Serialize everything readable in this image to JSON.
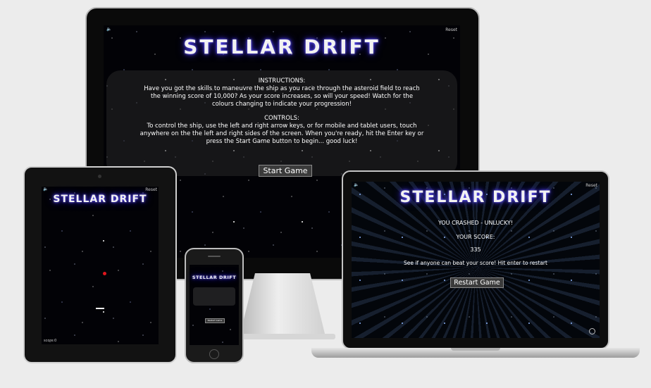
{
  "game": {
    "title": "STELLAR DRIFT",
    "reset_label": "Reset",
    "sound_icon": "speaker-icon",
    "instructions_heading": "INSTRUCTIONS:",
    "instructions_line1": "Have you got the skills to maneuvre the ship as you race through the asteroid field to reach",
    "instructions_line2": "the winning score of 10,000? As your score increases, so will your speed! Watch for the",
    "instructions_line3": "colours changing to indicate your progression!",
    "controls_heading": "CONTROLS:",
    "controls_line1": "To control the ship, use the left and right arrow keys, or for mobile and tablet users, touch",
    "controls_line2": "anywhere on the the left and right sides of the screen. When you're ready, hit the Enter key or",
    "controls_line3": "press the Start Game button to begin... good luck!",
    "start_button": "Start Game",
    "restart_button": "Restart Game",
    "crash_message": "YOU CRASHED - UNLUCKY!",
    "score_heading": "YOUR SCORE:",
    "score_value": "335",
    "beat_message": "See if anyone can beat your score! Hit enter to restart",
    "tablet_score": "score:0"
  },
  "icons": {
    "github": "github-icon"
  },
  "colors": {
    "background": "#ececec",
    "screen": "#020206",
    "logo_glow": "#3b2ecc",
    "asteroid": "#e0151c"
  }
}
